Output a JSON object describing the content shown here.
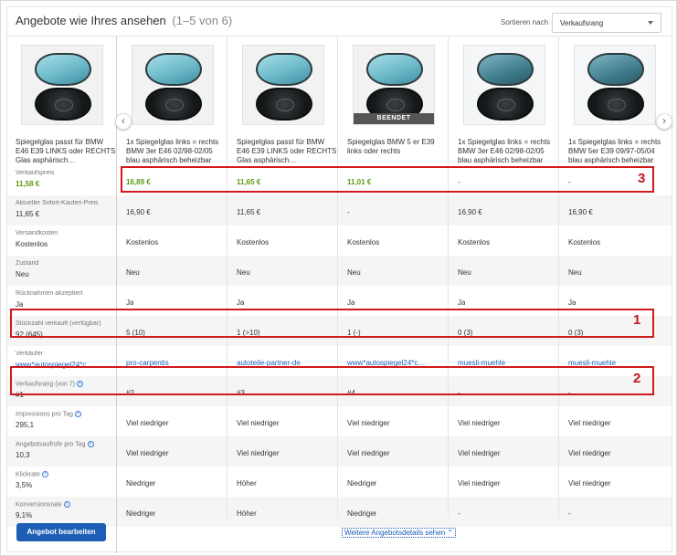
{
  "header": {
    "title": "Angebote wie Ihres ansehen",
    "count": "(1–5 von 6)",
    "sort_label": "Sortieren nach",
    "sort_value": "Verkaufsrang"
  },
  "listings": [
    {
      "title": "Spiegelglas passt für BMW E46 E39 LINKS oder RECHTS Glas asphärisch…",
      "badge": ""
    },
    {
      "title": "1x Spiegelglas links = rechts BMW 3er E46 02/98-02/05 blau asphärisch beheizbar",
      "badge": ""
    },
    {
      "title": "Spiegelglas passt für BMW E46 E39 LINKS oder RECHTS Glas asphärisch…",
      "badge": ""
    },
    {
      "title": "Spiegelglas BMW 5 er E39 links oder rechts",
      "badge": "BEENDET"
    },
    {
      "title": "1x Spiegelglas links = rechts BMW 3er E46 02/98-02/05 blau asphärisch beheizbar",
      "badge": ""
    },
    {
      "title": "1x Spiegelglas links = rechts BMW 5er E39 09/97-05/04 blau asphärisch beheizbar",
      "badge": ""
    }
  ],
  "rows": [
    {
      "label": "Verkaufspreis",
      "values": [
        "11,58 €",
        "16,89 €",
        "11,65 €",
        "11,01 €",
        "-",
        "-"
      ]
    },
    {
      "label": "Aktueller Sofort-Kaufen-Preis",
      "values": [
        "11,65 €",
        "16,90 €",
        "11,65 €",
        "-",
        "16,90 €",
        "16,90 €"
      ]
    },
    {
      "label": "Versandkosten",
      "values": [
        "Kostenlos",
        "Kostenlos",
        "Kostenlos",
        "Kostenlos",
        "Kostenlos",
        "Kostenlos"
      ]
    },
    {
      "label": "Zustand",
      "values": [
        "Neu",
        "Neu",
        "Neu",
        "Neu",
        "Neu",
        "Neu"
      ]
    },
    {
      "label": "Rücknahmen akzeptiert",
      "values": [
        "Ja",
        "Ja",
        "Ja",
        "Ja",
        "Ja",
        "Ja"
      ]
    },
    {
      "label": "Stückzahl verkauft (verfügbar)",
      "values": [
        "92 (645)",
        "5 (10)",
        "1 (>10)",
        "1 (-)",
        "0 (3)",
        "0 (3)"
      ]
    },
    {
      "label": "Verkäufer",
      "values": [
        "www*autospiegel24*c…",
        "pro-carpentis",
        "autoteile-partner-de",
        "www*autospiegel24*c…",
        "muesli-muehle",
        "muesli-muehle"
      ]
    },
    {
      "label": "Verkaufsrang (von 7)",
      "values": [
        "#1",
        "#2",
        "#3",
        "#4",
        "-",
        "-"
      ]
    },
    {
      "label": "Impressions pro Tag",
      "values": [
        "295,1",
        "Viel niedriger",
        "Viel niedriger",
        "Viel niedriger",
        "Viel niedriger",
        "Viel niedriger"
      ]
    },
    {
      "label": "Angebotsaufrufe pro Tag",
      "values": [
        "10,3",
        "Viel niedriger",
        "Viel niedriger",
        "Viel niedriger",
        "Viel niedriger",
        "Viel niedriger"
      ]
    },
    {
      "label": "Klickrate",
      "values": [
        "3,5%",
        "Niedriger",
        "Höher",
        "Niedriger",
        "Viel niedriger",
        "Viel niedriger"
      ]
    },
    {
      "label": "Konversionsrate",
      "values": [
        "9,1%",
        "Niedriger",
        "Höher",
        "Niedriger",
        "-",
        "-"
      ]
    }
  ],
  "footer": {
    "edit_button": "Angebot bearbeiten",
    "more_link": "Weitere Angebotsdetails sehen"
  },
  "annotations": [
    "1",
    "2",
    "3"
  ],
  "colors": {
    "highlight": "#d11a1a",
    "price_green": "#5a9a0f",
    "link_blue": "#1a5bb8",
    "button_blue": "#1d5fb5"
  }
}
